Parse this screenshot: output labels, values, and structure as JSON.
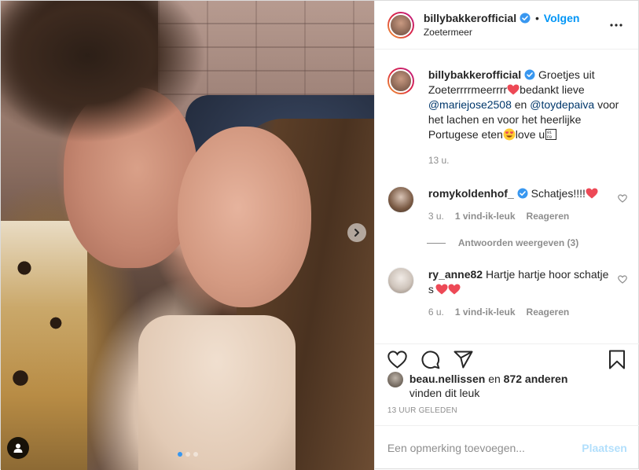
{
  "post": {
    "username": "billybakkerofficial",
    "location": "Zoetermeer",
    "follow_label": "Volgen",
    "separator": "•"
  },
  "caption": {
    "username": "billybakkerofficial",
    "text_1": "Groetjes uit Zoeterrrrmeerrrr",
    "text_2": "bedankt lieve",
    "mention_1": "@mariejose2508",
    "text_3": "en",
    "mention_2": "@toydepaiva",
    "text_4": "voor het lachen en voor het heerlijke Portugese eten",
    "text_5": "love u",
    "time": "13 u."
  },
  "comments": [
    {
      "username": "romykoldenhof_",
      "text": "Schatjes!!!!",
      "time": "3 u.",
      "likes": "1 vind-ik-leuk",
      "reply": "Reageren",
      "view_replies": "Antwoorden weergeven (3)"
    },
    {
      "username": "ry_anne82",
      "text": "Hartje hartje hoor schatje s",
      "time": "6 u.",
      "likes": "1 vind-ik-leuk",
      "reply": "Reageren"
    }
  ],
  "likes": {
    "user": "beau.nellissen",
    "connector": "en",
    "others": "872 anderen",
    "suffix": "vinden dit leuk"
  },
  "date": "13 UUR GELEDEN",
  "add_comment": {
    "placeholder": "Een opmerking toevoegen...",
    "post_label": "Plaatsen"
  },
  "carousel": {
    "count": 3,
    "active_index": 0
  },
  "colors": {
    "link": "#0095f6",
    "mention": "#00376b",
    "heart": "#ed4956",
    "muted": "#8e8e8e"
  },
  "icons": [
    "verified-badge-icon",
    "more-options-icon",
    "heart-icon",
    "comment-icon",
    "share-icon",
    "bookmark-icon",
    "chevron-right-icon",
    "user-tag-icon"
  ]
}
